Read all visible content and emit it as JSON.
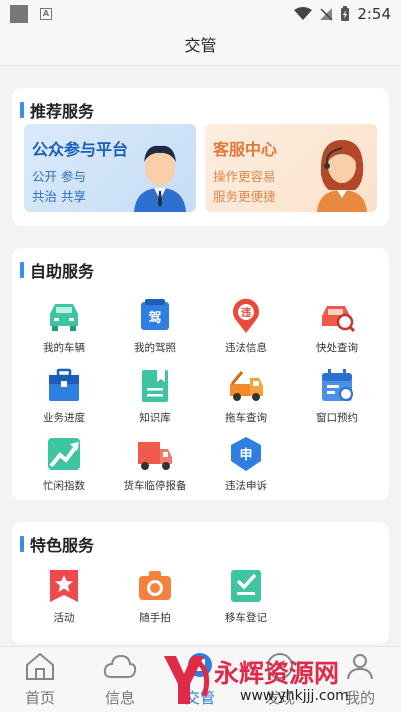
{
  "status": {
    "time": "2:54"
  },
  "title": "交管",
  "recommended": {
    "heading": "推荐服务",
    "cards": [
      {
        "title": "公众参与平台",
        "line1": "公开  参与",
        "line2": "共治  共享"
      },
      {
        "title": "客服中心",
        "line1": "操作更容易",
        "line2": "服务更便捷"
      }
    ]
  },
  "self_service": {
    "heading": "自助服务",
    "items": [
      {
        "label": "我的车辆",
        "icon": "car-icon"
      },
      {
        "label": "我的驾照",
        "icon": "license-icon"
      },
      {
        "label": "违法信息",
        "icon": "violation-icon"
      },
      {
        "label": "快处查询",
        "icon": "car-search-icon"
      },
      {
        "label": "业务进度",
        "icon": "briefcase-icon"
      },
      {
        "label": "知识库",
        "icon": "book-icon"
      },
      {
        "label": "拖车查询",
        "icon": "tow-truck-icon"
      },
      {
        "label": "窗口预约",
        "icon": "calendar-icon"
      },
      {
        "label": "忙闲指数",
        "icon": "trend-icon"
      },
      {
        "label": "货车临停报备",
        "icon": "truck-icon"
      },
      {
        "label": "违法申诉",
        "icon": "appeal-icon"
      }
    ]
  },
  "featured": {
    "heading": "特色服务",
    "items": [
      {
        "label": "活动",
        "icon": "star-badge-icon"
      },
      {
        "label": "随手拍",
        "icon": "camera-icon"
      },
      {
        "label": "移车登记",
        "icon": "checklist-icon"
      }
    ]
  },
  "tabs": [
    {
      "label": "首页",
      "icon": "home-icon"
    },
    {
      "label": "信息",
      "icon": "cloud-icon"
    },
    {
      "label": "交管",
      "icon": "traffic-icon"
    },
    {
      "label": "发现",
      "icon": "discover-icon"
    },
    {
      "label": "我的",
      "icon": "profile-icon"
    }
  ],
  "watermark": {
    "brand": "永辉资源网",
    "url": "www.yhkjjj.com"
  }
}
